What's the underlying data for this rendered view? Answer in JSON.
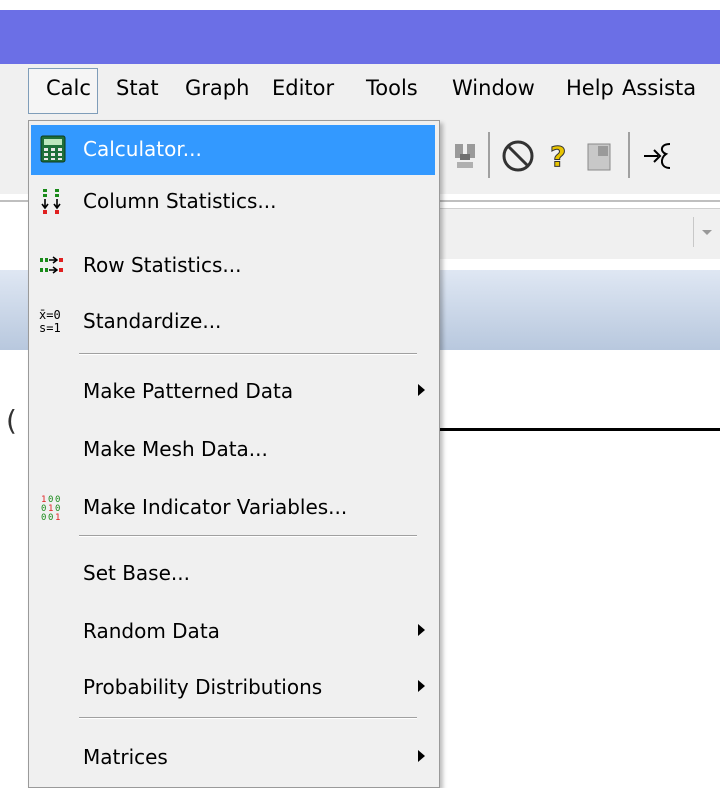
{
  "menubar": {
    "items": [
      "Calc",
      "Stat",
      "Graph",
      "Editor",
      "Tools",
      "Window",
      "Help",
      "Assista"
    ]
  },
  "calc_menu": {
    "items": [
      {
        "label": "Calculator...",
        "icon": "calculator-icon",
        "highlighted": true
      },
      {
        "label": "Column Statistics...",
        "icon": "column-statistics-icon"
      },
      {
        "label": "Row Statistics...",
        "icon": "row-statistics-icon"
      },
      {
        "label": "Standardize...",
        "icon": "standardize-icon",
        "icon_text": "x̄=0\ns=1"
      },
      {
        "label": "Make Patterned Data",
        "submenu": true
      },
      {
        "label": "Make Mesh Data..."
      },
      {
        "label": "Make Indicator Variables...",
        "icon": "indicator-variables-icon"
      },
      {
        "label": "Set Base..."
      },
      {
        "label": "Random Data",
        "submenu": true
      },
      {
        "label": "Probability Distributions",
        "submenu": true
      },
      {
        "label": "Matrices",
        "submenu": true
      }
    ]
  },
  "colors": {
    "title_bar": "#6b6fe6",
    "highlight": "#3399ff",
    "menu_bg": "#f0f0f0"
  }
}
